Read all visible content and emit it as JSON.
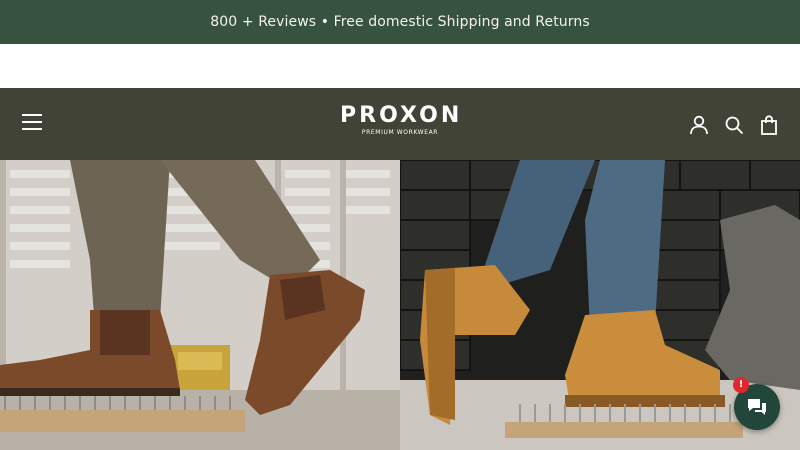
{
  "announcement": {
    "text": "800 + Reviews • Free domestic Shipping and Returns"
  },
  "header": {
    "brand": "PROXON",
    "tagline": "PREMIUM WORKWEAR",
    "icons": {
      "menu": "hamburger-menu-icon",
      "account": "user-icon",
      "search": "search-icon",
      "cart": "shopping-bag-icon"
    }
  },
  "hero": {
    "left_image": "brown chelsea work boot stepping on nail board in warehouse",
    "right_image": "tan lace-up work boot stepping on nail board beside metal anvil"
  },
  "chat": {
    "badge": "!",
    "icon": "chat-bubble-icon"
  },
  "colors": {
    "announcement_bg": "#37523f",
    "header_bg": "#424337",
    "chat_bg": "#22463a",
    "badge": "#e3262c"
  }
}
